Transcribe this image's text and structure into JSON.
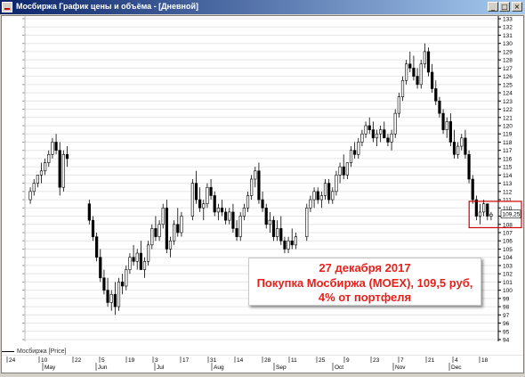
{
  "window": {
    "title": "Мосбиржа График цены и объёма - [Дневной]",
    "controls": [
      "_",
      "□",
      "×"
    ]
  },
  "callout": {
    "line1": "27 декабря 2017",
    "line2": "Покупка Мосбиржа (MOEX), 109,5 руб,",
    "line3": "4% от портфеля"
  },
  "legend": {
    "label": "Мосбиржа [Price]"
  },
  "price_badge": "109,25",
  "colors": {
    "candle": "#000000",
    "highlight": "#d00000",
    "callout_text": "#e8201a",
    "grid": "#e6e6e6"
  },
  "chart_data": {
    "type": "candlestick",
    "ylim": [
      94,
      133
    ],
    "y_ticks": [
      94,
      95,
      96,
      97,
      98,
      99,
      100,
      101,
      102,
      103,
      104,
      105,
      106,
      107,
      108,
      109,
      110,
      111,
      112,
      113,
      114,
      115,
      116,
      117,
      118,
      119,
      120,
      121,
      122,
      123,
      124,
      125,
      126,
      127,
      128,
      129,
      130,
      131,
      132,
      133
    ],
    "x_day_labels": [
      "24",
      "10",
      "22",
      "5",
      "19",
      "3",
      "17",
      "31",
      "14",
      "28",
      "11",
      "25",
      "9",
      "23",
      "7",
      "21",
      "4",
      "18"
    ],
    "x_month_labels": [
      "May",
      "Jun",
      "Jul",
      "Aug",
      "Sep",
      "Oct",
      "Nov",
      "Dec"
    ],
    "series": [
      {
        "values": [
          [
            111.0,
            112.5,
            110.5,
            112.0
          ],
          [
            112.0,
            113.5,
            111.5,
            113.0
          ],
          [
            113.0,
            114.0,
            112.5,
            114.0
          ],
          [
            114.0,
            115.5,
            113.0,
            114.5
          ],
          [
            114.5,
            116.0,
            114.0,
            115.5
          ],
          [
            115.5,
            117.0,
            115.0,
            116.5
          ],
          [
            116.5,
            118.5,
            116.0,
            118.0
          ],
          [
            118.0,
            119.0,
            116.5,
            117.0
          ],
          [
            117.0,
            118.0,
            111.5,
            112.5
          ],
          [
            112.5,
            117.0,
            112.0,
            116.5
          ],
          [
            116.5,
            117.5,
            115.0,
            116.0
          ],
          [
            110.5,
            111.0,
            108.0,
            108.5
          ],
          [
            108.5,
            109.0,
            106.0,
            106.5
          ],
          [
            106.5,
            107.0,
            103.5,
            104.0
          ],
          [
            104.0,
            105.0,
            101.0,
            101.5
          ],
          [
            101.5,
            102.5,
            99.5,
            100.0
          ],
          [
            100.0,
            101.5,
            98.0,
            98.5
          ],
          [
            98.5,
            100.0,
            97.5,
            99.5
          ],
          [
            99.5,
            101.0,
            97.0,
            98.0
          ],
          [
            98.0,
            101.5,
            97.5,
            101.0
          ],
          [
            101.0,
            102.0,
            99.5,
            100.5
          ],
          [
            100.5,
            103.0,
            100.0,
            102.5
          ],
          [
            102.5,
            104.5,
            102.0,
            104.0
          ],
          [
            104.0,
            105.5,
            103.0,
            103.5
          ],
          [
            103.5,
            105.0,
            102.5,
            104.5
          ],
          [
            104.5,
            106.0,
            103.5,
            102.5
          ],
          [
            102.5,
            104.0,
            101.5,
            103.5
          ],
          [
            103.5,
            106.0,
            103.0,
            105.5
          ],
          [
            105.5,
            108.0,
            105.0,
            107.5
          ],
          [
            107.5,
            109.0,
            106.0,
            106.5
          ],
          [
            106.5,
            108.5,
            106.0,
            108.0
          ],
          [
            108.0,
            110.5,
            107.5,
            110.0
          ],
          [
            110.0,
            111.0,
            104.5,
            105.0
          ],
          [
            105.0,
            106.5,
            104.0,
            106.0
          ],
          [
            106.0,
            108.5,
            105.5,
            108.0
          ],
          [
            108.0,
            110.0,
            106.5,
            107.0
          ],
          [
            107.0,
            109.5,
            106.5,
            109.0
          ],
          [
            109.0,
            113.5,
            108.5,
            113.0
          ],
          [
            113.0,
            114.5,
            110.5,
            111.0
          ],
          [
            111.0,
            112.5,
            109.5,
            110.0
          ],
          [
            110.0,
            111.0,
            108.5,
            110.5
          ],
          [
            110.5,
            113.0,
            110.0,
            112.5
          ],
          [
            112.5,
            113.5,
            111.0,
            111.5
          ],
          [
            111.5,
            112.0,
            109.0,
            109.5
          ],
          [
            109.5,
            110.5,
            108.5,
            110.0
          ],
          [
            110.0,
            111.0,
            109.0,
            109.5
          ],
          [
            109.5,
            110.0,
            108.0,
            108.5
          ],
          [
            108.5,
            110.0,
            108.0,
            109.5
          ],
          [
            109.5,
            110.5,
            107.0,
            107.5
          ],
          [
            107.5,
            108.5,
            106.0,
            106.5
          ],
          [
            106.5,
            109.5,
            106.0,
            109.0
          ],
          [
            109.0,
            110.5,
            108.5,
            110.0
          ],
          [
            110.0,
            112.0,
            109.5,
            111.5
          ],
          [
            111.5,
            114.0,
            111.0,
            113.5
          ],
          [
            113.5,
            115.0,
            112.5,
            114.5
          ],
          [
            114.5,
            115.5,
            110.5,
            111.0
          ],
          [
            111.0,
            112.0,
            109.5,
            110.0
          ],
          [
            110.0,
            110.5,
            107.5,
            108.0
          ],
          [
            108.0,
            109.5,
            107.0,
            108.5
          ],
          [
            108.5,
            109.0,
            106.0,
            106.5
          ],
          [
            106.5,
            108.5,
            106.0,
            107.5
          ],
          [
            107.5,
            109.0,
            105.5,
            106.0
          ],
          [
            106.0,
            106.5,
            104.5,
            105.0
          ],
          [
            105.0,
            106.5,
            104.5,
            106.0
          ],
          [
            106.0,
            107.5,
            105.0,
            105.5
          ],
          [
            105.5,
            107.0,
            105.0,
            106.5
          ],
          [
            106.5,
            110.5,
            106.0,
            110.0
          ],
          [
            110.0,
            111.5,
            109.5,
            111.0
          ],
          [
            111.0,
            112.5,
            110.0,
            112.0
          ],
          [
            112.0,
            112.5,
            110.5,
            111.0
          ],
          [
            111.0,
            112.0,
            110.0,
            111.5
          ],
          [
            111.5,
            113.5,
            111.0,
            113.0
          ],
          [
            113.0,
            113.5,
            110.5,
            111.0
          ],
          [
            111.0,
            112.5,
            110.5,
            112.0
          ],
          [
            112.0,
            114.5,
            111.5,
            114.0
          ],
          [
            114.0,
            115.5,
            113.0,
            115.0
          ],
          [
            115.0,
            116.5,
            113.5,
            114.0
          ],
          [
            114.0,
            115.5,
            113.5,
            115.5
          ],
          [
            115.5,
            117.5,
            115.0,
            117.0
          ],
          [
            117.0,
            118.0,
            116.0,
            116.5
          ],
          [
            116.5,
            118.5,
            116.0,
            118.0
          ],
          [
            118.0,
            119.5,
            117.5,
            119.0
          ],
          [
            119.0,
            120.5,
            118.5,
            120.0
          ],
          [
            120.0,
            121.0,
            119.0,
            119.5
          ],
          [
            119.5,
            120.5,
            118.0,
            118.5
          ],
          [
            118.5,
            119.5,
            117.5,
            119.0
          ],
          [
            119.0,
            120.0,
            118.0,
            119.5
          ],
          [
            119.5,
            120.5,
            118.5,
            118.5
          ],
          [
            118.5,
            119.0,
            117.5,
            118.0
          ],
          [
            118.0,
            119.5,
            117.0,
            119.0
          ],
          [
            119.0,
            122.0,
            118.5,
            121.5
          ],
          [
            121.5,
            124.0,
            121.0,
            123.5
          ],
          [
            123.5,
            126.0,
            123.0,
            125.5
          ],
          [
            125.5,
            128.0,
            125.0,
            127.5
          ],
          [
            127.5,
            129.0,
            126.5,
            127.0
          ],
          [
            127.0,
            128.5,
            125.5,
            126.0
          ],
          [
            126.0,
            127.0,
            124.5,
            125.0
          ],
          [
            125.0,
            128.0,
            124.5,
            127.5
          ],
          [
            127.5,
            130.0,
            127.0,
            129.0
          ],
          [
            129.0,
            129.5,
            126.0,
            126.5
          ],
          [
            126.5,
            127.5,
            124.0,
            124.5
          ],
          [
            124.5,
            125.5,
            122.5,
            123.0
          ],
          [
            123.0,
            123.5,
            121.0,
            121.5
          ],
          [
            121.5,
            122.0,
            119.0,
            119.5
          ],
          [
            119.5,
            121.0,
            118.5,
            120.5
          ],
          [
            120.5,
            121.5,
            117.5,
            118.0
          ],
          [
            118.0,
            119.5,
            116.0,
            116.5
          ],
          [
            116.5,
            118.0,
            116.0,
            117.5
          ],
          [
            117.5,
            119.0,
            117.0,
            118.5
          ],
          [
            118.5,
            119.5,
            116.0,
            116.5
          ],
          [
            116.5,
            117.0,
            113.0,
            113.5
          ],
          [
            113.5,
            114.0,
            110.5,
            111.0
          ],
          [
            111.0,
            111.5,
            108.5,
            109.0
          ],
          [
            109.0,
            110.5,
            108.0,
            109.5
          ],
          [
            109.5,
            111.0,
            109.0,
            110.5
          ],
          [
            110.5,
            110.5,
            108.5,
            109.0
          ],
          [
            109.0,
            109.5,
            108.5,
            109.25
          ]
        ]
      }
    ]
  }
}
